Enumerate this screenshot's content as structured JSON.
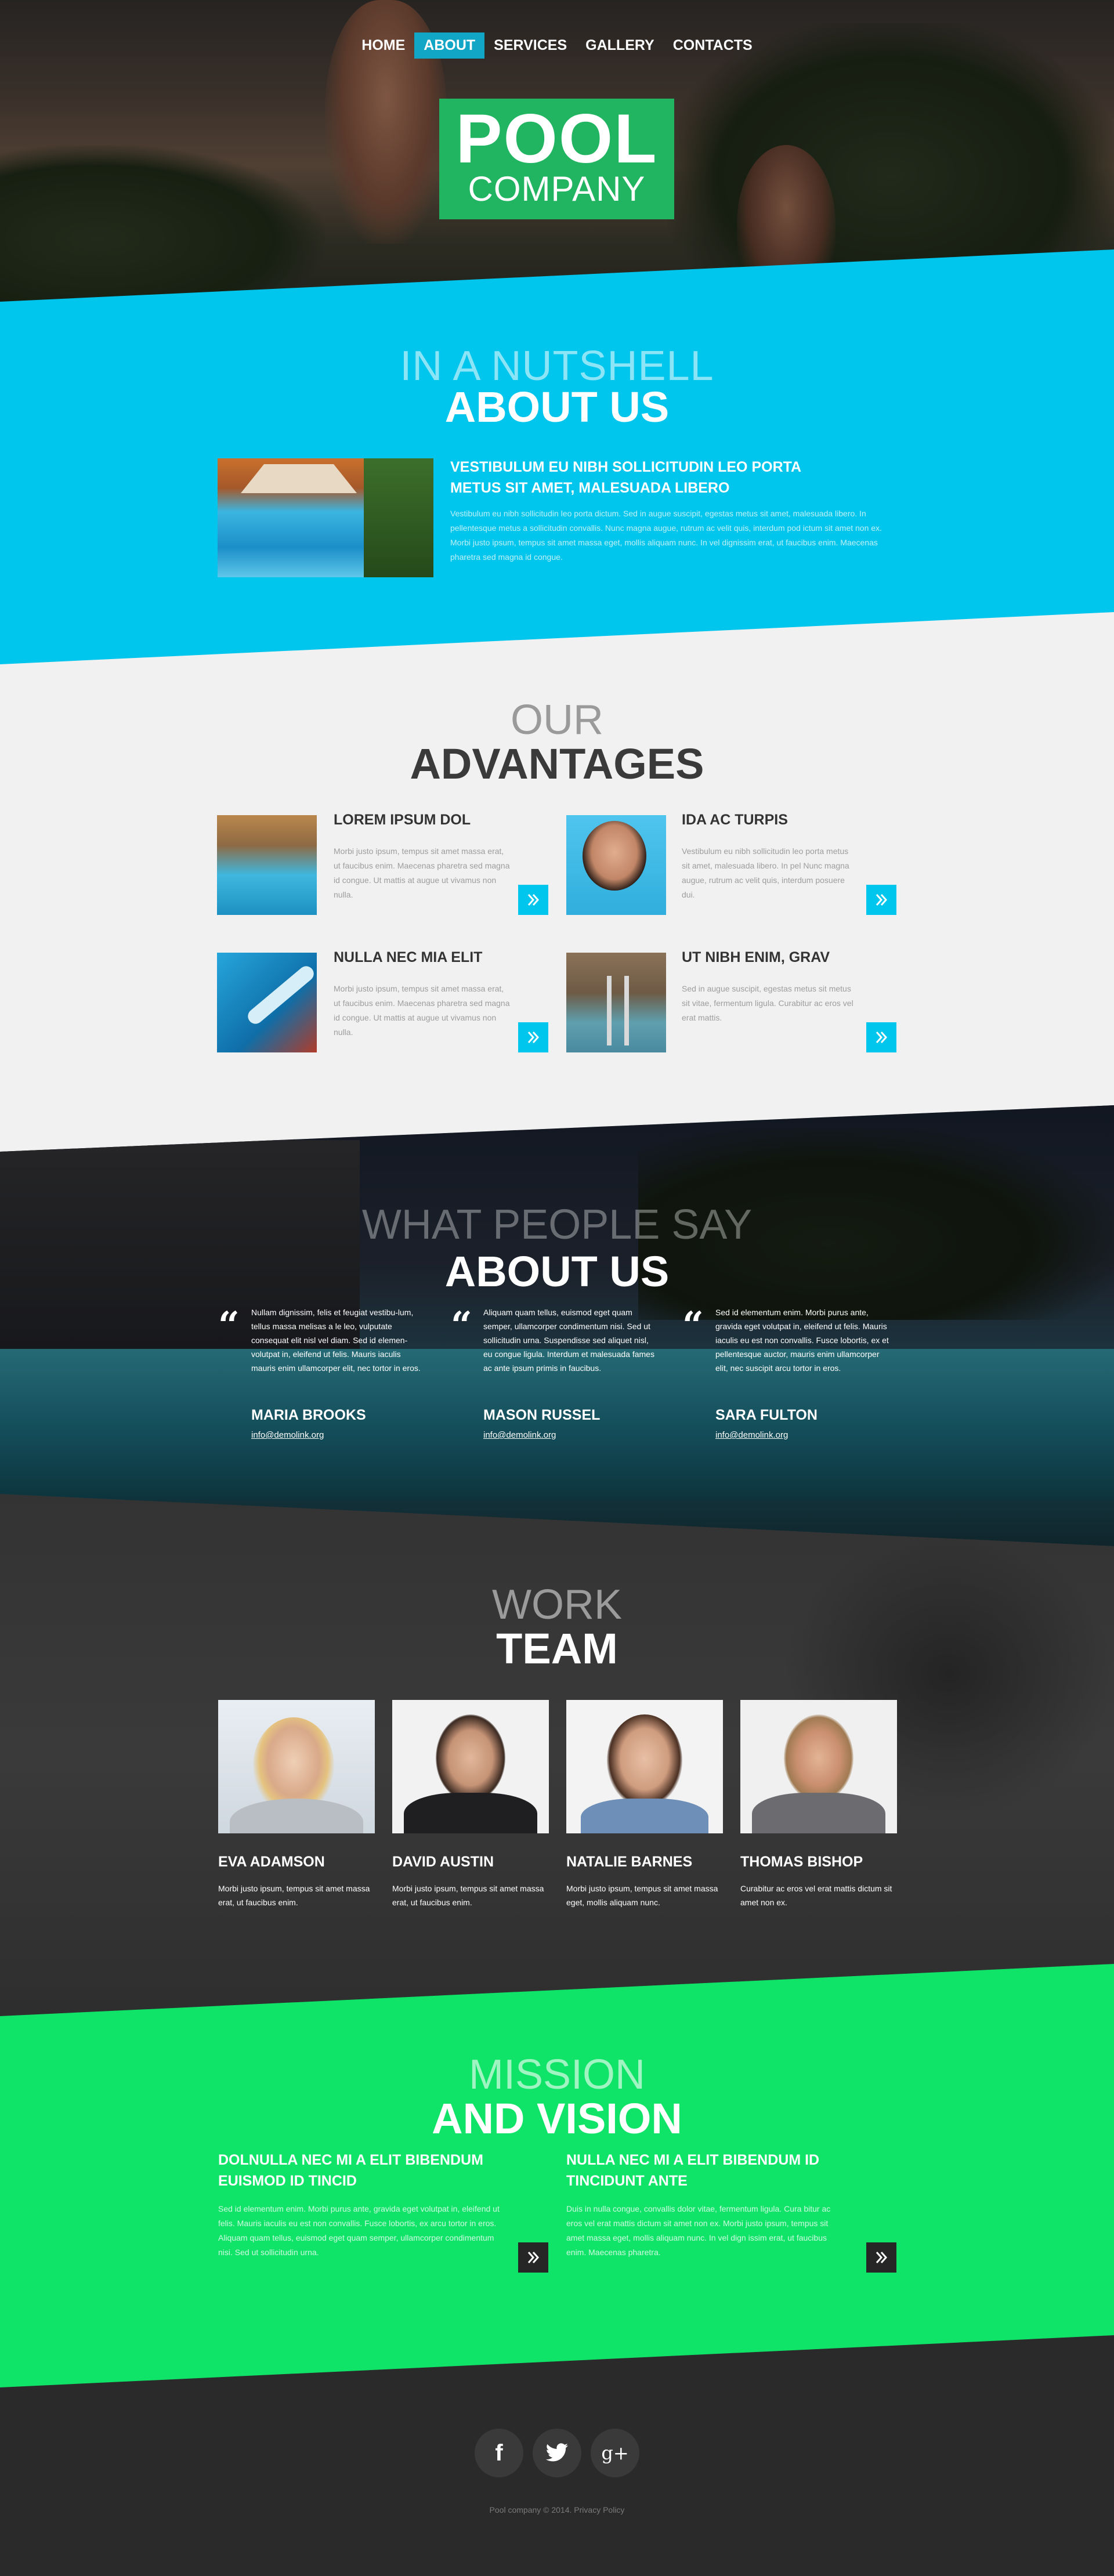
{
  "colors": {
    "cyan": "#00c5ec",
    "light": "#f1f1f1",
    "dark": "#2a2a2a",
    "green": "#0fe468",
    "footer": "#242424",
    "logo": "#21b461",
    "active": "#11a5c6"
  },
  "nav": {
    "items": [
      "HOME",
      "ABOUT",
      "SERVICES",
      "GALLERY",
      "CONTACTS"
    ],
    "active": "ABOUT"
  },
  "logo": {
    "line1": "POOL",
    "line2": "COMPANY"
  },
  "about": {
    "kicker": "IN A NUTSHELL",
    "title": "ABOUT US",
    "heading": "VESTIBULUM EU NIBH SOLLICITUDIN LEO PORTA METUS SIT AMET, MALESUADA LIBERO",
    "text": "Vestibulum eu nibh sollicitudin leo porta dictum. Sed in augue suscipit, egestas metus sit amet, malesuada libero. In pellentesque metus a sollicitudin convallis. Nunc magna augue, rutrum ac velit quis, interdum pod ictum sit amet non ex. Morbi justo ipsum, tempus sit amet massa eget, mollis aliquam nunc. In vel dignissim erat, ut faucibus enim. Maecenas pharetra sed magna id congue."
  },
  "advantages": {
    "kicker": "OUR",
    "title": "ADVANTAGES",
    "items": [
      {
        "title": "LOREM IPSUM DOL",
        "text": "Morbi justo ipsum, tempus sit amet massa erat, ut faucibus enim. Maecenas pharetra sed magna id congue. Ut mattis at augue ut vivamus non nulla."
      },
      {
        "title": "IDA AC TURPIS",
        "text": "Vestibulum eu nibh sollicitudin leo porta metus sit amet, malesuada libero. In pel Nunc magna augue, rutrum ac velit quis, interdum posuere dui."
      },
      {
        "title": "NULLA NEC MIA ELIT",
        "text": "Morbi justo ipsum, tempus sit amet massa erat, ut faucibus enim. Maecenas pharetra sed magna id congue. Ut mattis at augue ut vivamus non nulla."
      },
      {
        "title": "UT NIBH ENIM, GRAV",
        "text": "Sed in augue suscipit, egestas metus sit metus sit vitae, fermentum ligula. Curabitur ac eros vel erat mattis."
      }
    ]
  },
  "testimonials": {
    "kicker": "WHAT PEOPLE SAY",
    "title": "ABOUT US",
    "items": [
      {
        "text": "Nullam dignissim, felis et feugiat vestibu-lum, tellus massa melisas a le leo, vulputate consequat elit nisl vel diam. Sed id elemen-volutpat in, eleifend ut felis. Mauris iaculis mauris enim ullamcorper elit, nec tortor in eros.",
        "name": "MARIA BROOKS",
        "email": "info@demolink.org"
      },
      {
        "text": "Aliquam quam tellus, euismod eget quam semper, ullamcorper condimentum nisi. Sed ut sollicitudin urna. Suspendisse sed aliquet nisl, eu congue ligula. Interdum et malesuada fames ac ante ipsum primis in faucibus.",
        "name": "MASON RUSSEL",
        "email": "info@demolink.org"
      },
      {
        "text": "Sed id elementum enim. Morbi purus ante, gravida eget volutpat in, eleifend ut felis. Mauris iaculis eu est non convallis. Fusce lobortis, ex et pellentesque auctor, mauris enim ullamcorper elit, nec suscipit arcu tortor in eros.",
        "name": "SARA FULTON",
        "email": "info@demolink.org"
      }
    ]
  },
  "team": {
    "kicker": "WORK",
    "title": "TEAM",
    "members": [
      {
        "name": "EVA ADAMSON",
        "text": "Morbi justo ipsum, tempus sit amet massa erat, ut faucibus enim."
      },
      {
        "name": "DAVID AUSTIN",
        "text": "Morbi justo ipsum, tempus sit amet massa erat, ut faucibus enim."
      },
      {
        "name": "NATALIE BARNES",
        "text": "Morbi justo ipsum, tempus sit amet massa eget, mollis aliquam nunc."
      },
      {
        "name": "THOMAS BISHOP",
        "text": "Curabitur ac eros vel erat mattis dictum sit amet non ex."
      }
    ]
  },
  "mission": {
    "kicker": "MISSION",
    "title": "AND VISION",
    "cols": [
      {
        "heading": "DOLNULLA NEC MI A ELIT BIBENDUM EUISMOD ID TINCID",
        "text": "Sed id elementum enim. Morbi purus ante, gravida eget volutpat in, eleifend ut felis. Mauris iaculis eu est non convallis. Fusce lobortis, ex arcu tortor in eros. Aliquam quam tellus, euismod eget quam semper, ullamcorper condimentum nisi. Sed ut sollicitudin urna."
      },
      {
        "heading": "NULLA NEC MI A ELIT BIBENDUM ID TINCIDUNT ANTE",
        "text": "Duis in nulla congue, convallis dolor vitae, fermentum ligula. Cura bitur ac eros vel erat mattis dictum sit amet non ex. Morbi justo ipsum, tempus sit amet massa eget, mollis aliquam nunc. In vel dign issim erat, ut faucibus enim. Maecenas pharetra."
      }
    ]
  },
  "footer": {
    "social": [
      "f",
      "twitter-bird",
      "g+"
    ],
    "copyright": "Pool company © 2014.",
    "privacy": "Privacy Policy"
  }
}
